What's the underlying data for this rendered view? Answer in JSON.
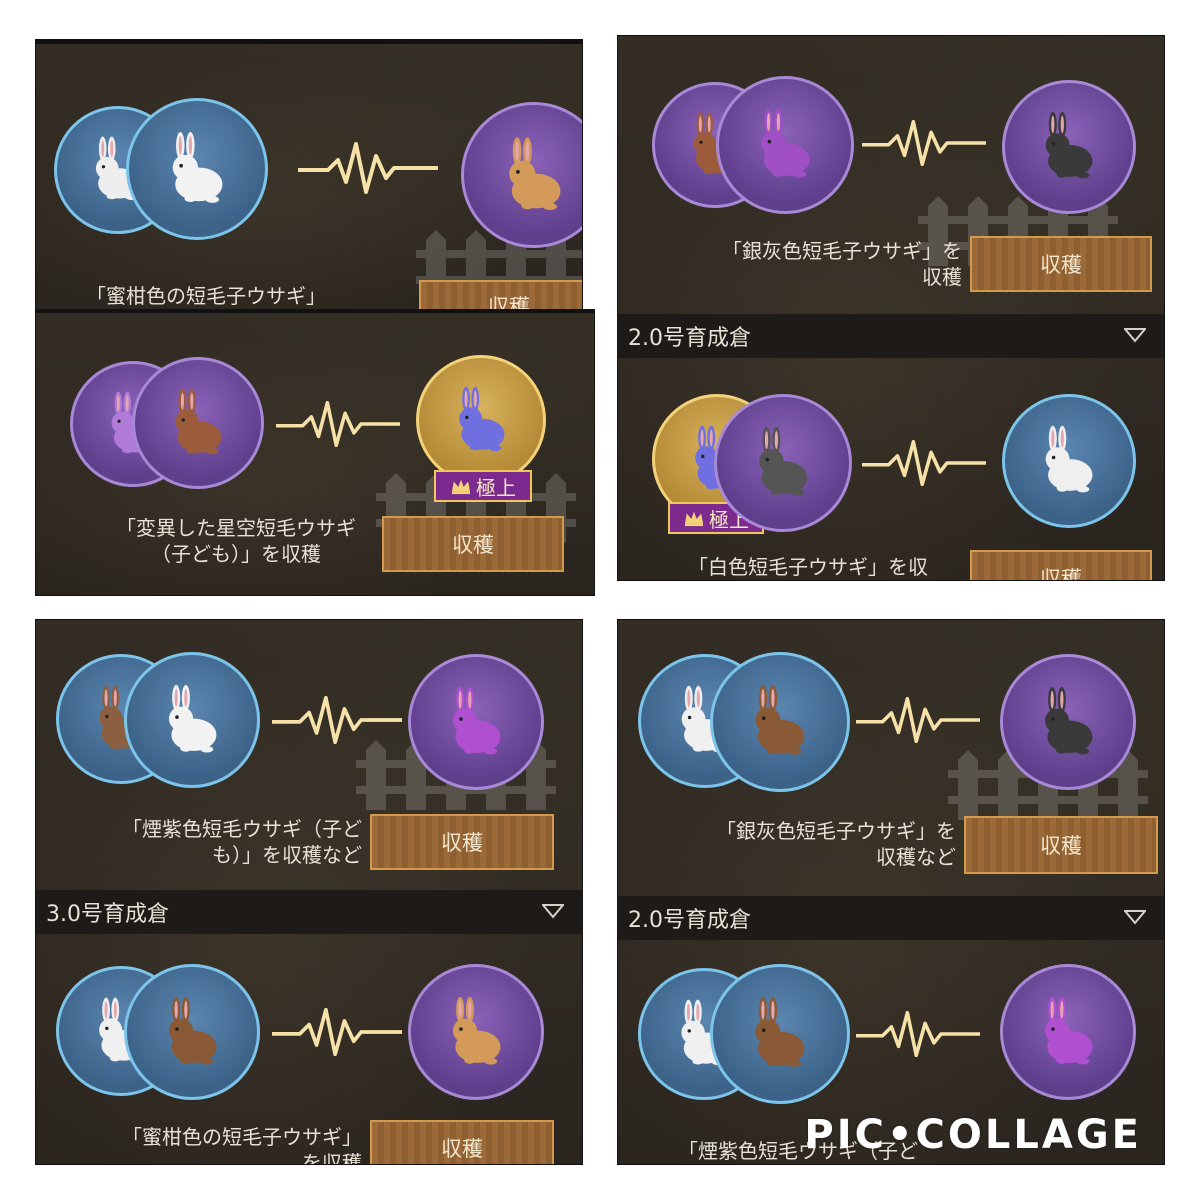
{
  "colors": {
    "blue_ring": "#7dc4ea",
    "purple_ring": "#a889d6",
    "gold_ring": "#f3d27a",
    "button": "#9c6a38",
    "button_border": "#d39a4e"
  },
  "harvest_label": "収穫",
  "panels": {
    "top_left": {
      "result_text": "「蜜柑色の短毛子ウサギ」",
      "parents": [
        "white rabbit (blue)",
        "white rabbit (blue)"
      ],
      "offspring": "orange-white rabbit (purple)"
    },
    "inset": {
      "result_text": "「変異した星空短毛ウサギ\n（子ども）」を収穫",
      "badge": "極上",
      "parents": [
        "purple rabbit (purple)",
        "brown-white rabbit (purple)"
      ],
      "offspring": "starry rabbit (gold)"
    },
    "top_right": {
      "row1_text": "「銀灰色短毛子ウサギ」を\n収穫",
      "section": "2.0号育成倉",
      "row2_text": "「白色短毛子ウサギ」を収",
      "badge": "極上"
    },
    "bottom_left": {
      "row1_text": "「煙紫色短毛ウサギ（子ど\nも）」を収穫など",
      "section": "3.0号育成倉",
      "row2_text": "「蜜柑色の短毛子ウサギ」\nを収穫"
    },
    "bottom_right": {
      "row1_text": "「銀灰色短毛子ウサギ」を\n収穫など",
      "section": "2.0号育成倉",
      "row2_text": "「煙紫色短毛ウサギ（子ど"
    }
  },
  "watermark": "PIC•COLLAGE",
  "icons": [
    "rabbit-icon",
    "pulse-icon",
    "crown-icon",
    "chevron-down-icon"
  ]
}
